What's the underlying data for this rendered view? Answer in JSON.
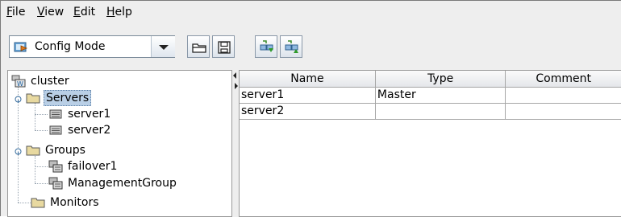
{
  "menu": [
    {
      "mnemonic": "F",
      "rest": "ile"
    },
    {
      "mnemonic": "V",
      "rest": "iew"
    },
    {
      "mnemonic": "E",
      "rest": "dit"
    },
    {
      "mnemonic": "H",
      "rest": "elp"
    }
  ],
  "toolbar": {
    "mode_label": "Config Mode",
    "mode_icon": "config-mode-icon",
    "buttons": [
      "open-folder-icon",
      "save-disk-icon",
      "download-icon",
      "upload-icon"
    ]
  },
  "tree": {
    "root": "cluster",
    "servers_label": "Servers",
    "servers": [
      "server1",
      "server2"
    ],
    "groups_label": "Groups",
    "groups": [
      "failover1",
      "ManagementGroup"
    ],
    "monitors_label": "Monitors"
  },
  "table": {
    "columns": [
      "Name",
      "Type",
      "Comment"
    ],
    "rows": [
      [
        "server1",
        "Master",
        ""
      ],
      [
        "server2",
        "",
        ""
      ]
    ]
  },
  "colors": {
    "selection": "#b9cfe6",
    "folder": "#e8d9a0"
  }
}
